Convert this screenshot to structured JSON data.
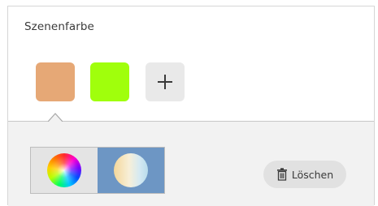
{
  "section": {
    "title": "Szenenfarbe"
  },
  "swatches": [
    {
      "color": "#e6a876",
      "selected": true
    },
    {
      "color": "#a0ff0c",
      "selected": false
    }
  ],
  "add_button": {
    "icon": "plus-icon"
  },
  "mode_toggle": {
    "options": [
      {
        "icon": "color-wheel-icon",
        "active": false
      },
      {
        "icon": "white-tone-icon",
        "active": true
      }
    ]
  },
  "delete_button": {
    "label": "Löschen",
    "icon": "trash-icon"
  },
  "colors": {
    "lower_background": "#f2f2f2",
    "active_mode": "#6d96c4",
    "button_gray": "#e1e1e1"
  }
}
